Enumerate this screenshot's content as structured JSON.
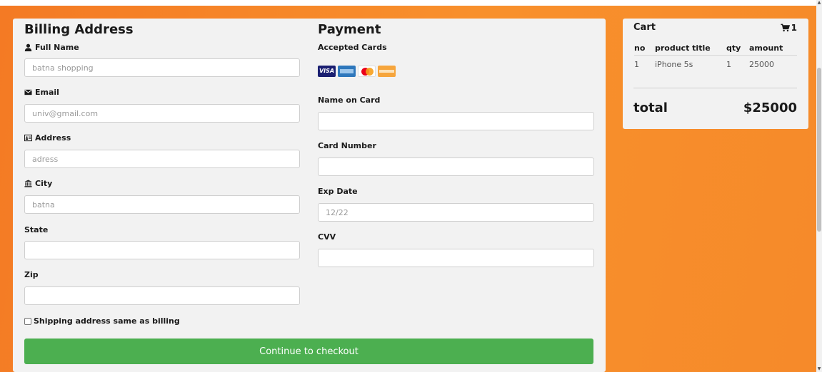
{
  "billing": {
    "heading": "Billing Address",
    "full_name": {
      "label": "Full Name",
      "placeholder": "batna shopping"
    },
    "email": {
      "label": "Email",
      "placeholder": "univ@gmail.com"
    },
    "address": {
      "label": "Address",
      "placeholder": "adress"
    },
    "city": {
      "label": "City",
      "placeholder": "batna"
    },
    "state": {
      "label": "State",
      "placeholder": ""
    },
    "zip": {
      "label": "Zip",
      "placeholder": ""
    }
  },
  "payment": {
    "heading": "Payment",
    "accepted_cards_label": "Accepted Cards",
    "cards": [
      "visa-card-icon",
      "amex-card-icon",
      "mastercard-card-icon",
      "discover-card-icon"
    ],
    "visa_text": "VISA",
    "name_on_card": {
      "label": "Name on Card",
      "placeholder": ""
    },
    "card_number": {
      "label": "Card Number",
      "placeholder": ""
    },
    "exp_date": {
      "label": "Exp Date",
      "placeholder": "12/22"
    },
    "cvv": {
      "label": "CVV",
      "placeholder": ""
    }
  },
  "shipping_same_label": "Shipping address same as billing",
  "checkout_label": "Continue to checkout",
  "cart": {
    "title": "Cart",
    "count": "1",
    "columns": [
      "no",
      "product title",
      "qty",
      "amount"
    ],
    "rows": [
      {
        "no": "1",
        "title": "iPhone 5s",
        "qty": "1",
        "amount": "25000"
      }
    ],
    "total_label": "total",
    "total_value": "$25000"
  },
  "colors": {
    "accent": "#4caf50",
    "background": "#f68a2a"
  }
}
